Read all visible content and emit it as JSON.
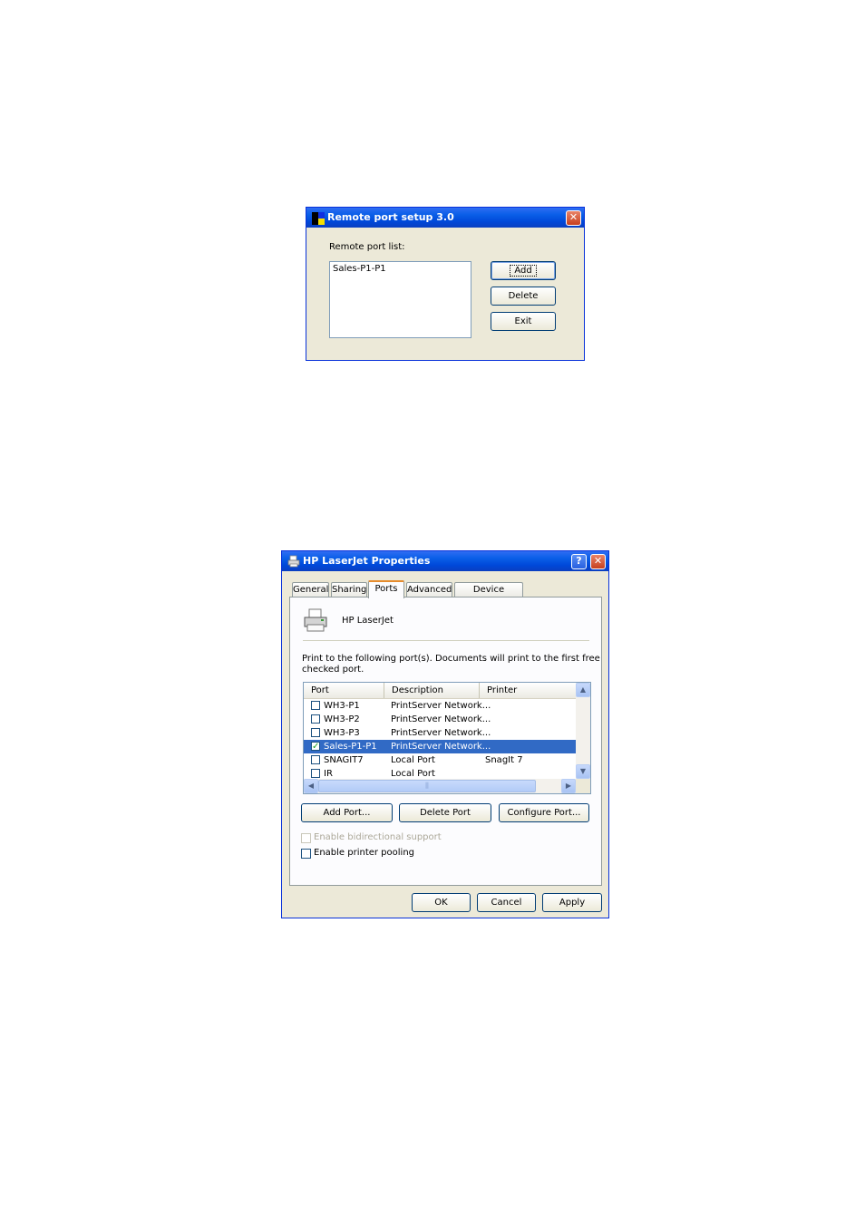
{
  "remote_dialog": {
    "title": "Remote port setup 3.0",
    "list_label": "Remote port list:",
    "list_items": [
      "Sales-P1-P1"
    ],
    "add_label": "Add",
    "delete_label": "Delete",
    "exit_label": "Exit"
  },
  "props_dialog": {
    "title": "HP LaserJet Properties",
    "tabs": [
      "General",
      "Sharing",
      "Ports",
      "Advanced",
      "Device Settings"
    ],
    "active_tab": "Ports",
    "printer_name": "HP LaserJet",
    "instructions_line1": "Print to the following port(s). Documents will print to the first free",
    "instructions_line2": "checked port.",
    "columns": [
      "Port",
      "Description",
      "Printer"
    ],
    "rows": [
      {
        "port": "WH3-P1",
        "description": "PrintServer Network...",
        "printer": "",
        "checked": false,
        "selected": false
      },
      {
        "port": "WH3-P2",
        "description": "PrintServer Network...",
        "printer": "",
        "checked": false,
        "selected": false
      },
      {
        "port": "WH3-P3",
        "description": "PrintServer Network...",
        "printer": "",
        "checked": false,
        "selected": false
      },
      {
        "port": "Sales-P1-P1",
        "description": "PrintServer Network...",
        "printer": "",
        "checked": true,
        "selected": true
      },
      {
        "port": "SNAGIT7",
        "description": "Local Port",
        "printer": "SnagIt 7",
        "checked": false,
        "selected": false
      },
      {
        "port": "IR",
        "description": "Local Port",
        "printer": "",
        "checked": false,
        "selected": false
      }
    ],
    "add_port_label": "Add Port...",
    "delete_port_label": "Delete Port",
    "configure_port_label": "Configure Port...",
    "bidirectional_label": "Enable bidirectional support",
    "pooling_label": "Enable printer pooling",
    "ok_label": "OK",
    "cancel_label": "Cancel",
    "apply_label": "Apply"
  }
}
